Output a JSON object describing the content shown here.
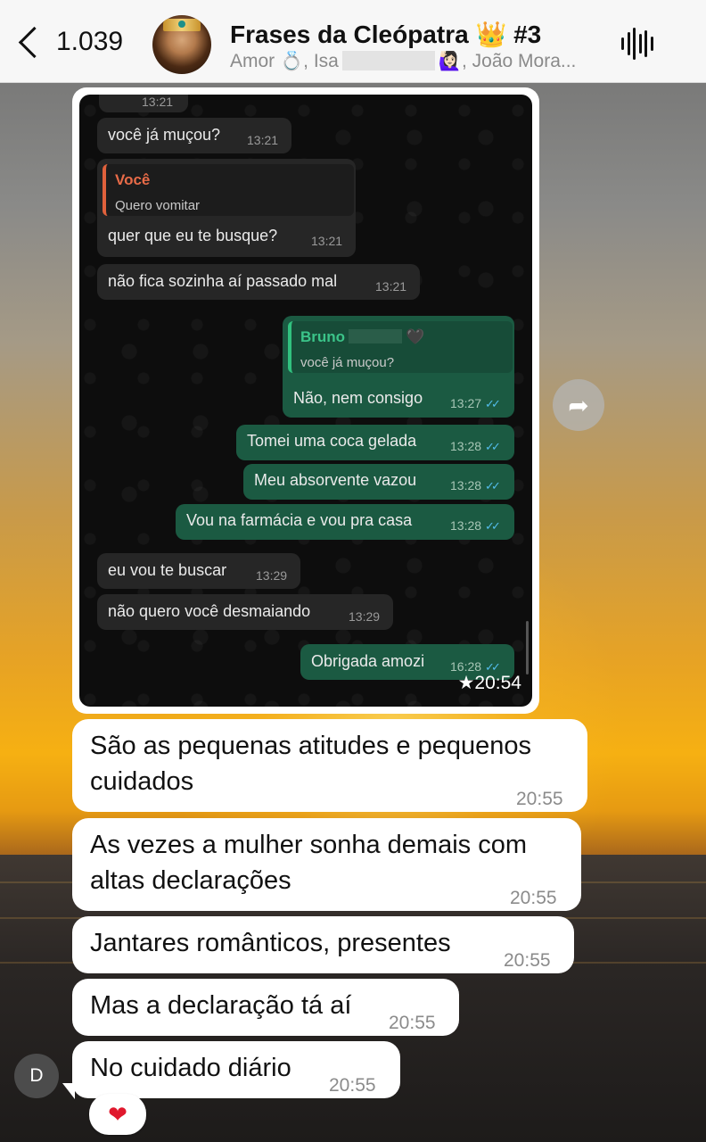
{
  "header": {
    "back_count": "1.039",
    "title": "Frases da Cleópatra 👑 #3",
    "subtitle_a": "Amor 💍, Isa",
    "subtitle_b": "🙋🏻‍♀️, João Mora..."
  },
  "screenshot": {
    "messages": [
      {
        "dir": "in",
        "text": "você já muçou?",
        "time": "13:21"
      },
      {
        "dir": "in",
        "quote_name": "Você",
        "quote_text": "Quero vomitar",
        "text": "quer que eu te busque?",
        "time": "13:21"
      },
      {
        "dir": "in",
        "text": "não fica sozinha aí passado mal",
        "time": "13:21"
      },
      {
        "dir": "out",
        "quote_name": "Bruno",
        "quote_suffix": "🖤",
        "quote_text": "você já muçou?",
        "text": "Não, nem consigo",
        "time": "13:27"
      },
      {
        "dir": "out",
        "text": "Tomei uma coca gelada",
        "time": "13:28"
      },
      {
        "dir": "out",
        "text": "Meu absorvente vazou",
        "time": "13:28"
      },
      {
        "dir": "out",
        "text": "Vou na farmácia e vou pra casa",
        "time": "13:28"
      },
      {
        "dir": "in",
        "text": "eu vou te buscar",
        "time": "13:29"
      },
      {
        "dir": "in",
        "text": "não quero você desmaiando",
        "time": "13:29"
      },
      {
        "dir": "out",
        "text": "Obrigada amozi",
        "time": "16:28"
      }
    ],
    "partial_top_time": "13:21",
    "star_time": "★20:54"
  },
  "chat": [
    {
      "text_1": "São as pequenas atitudes e pequenos",
      "text_2": "cuidados",
      "time": "20:55"
    },
    {
      "text_1": "As vezes a mulher sonha demais com",
      "text_2": "altas declarações",
      "time": "20:55"
    },
    {
      "text_1": "Jantares românticos, presentes",
      "time": "20:55"
    },
    {
      "text_1": "Mas a declaração tá aí",
      "time": "20:55"
    },
    {
      "text_1": "No cuidado diário",
      "time": "20:55"
    }
  ],
  "sender_avatar": "D",
  "reaction": "❤",
  "icons": {
    "back": "chevron-left-icon",
    "voice": "audio-waveform-icon",
    "forward": "forward-arrow-icon",
    "read": "double-check-icon"
  }
}
